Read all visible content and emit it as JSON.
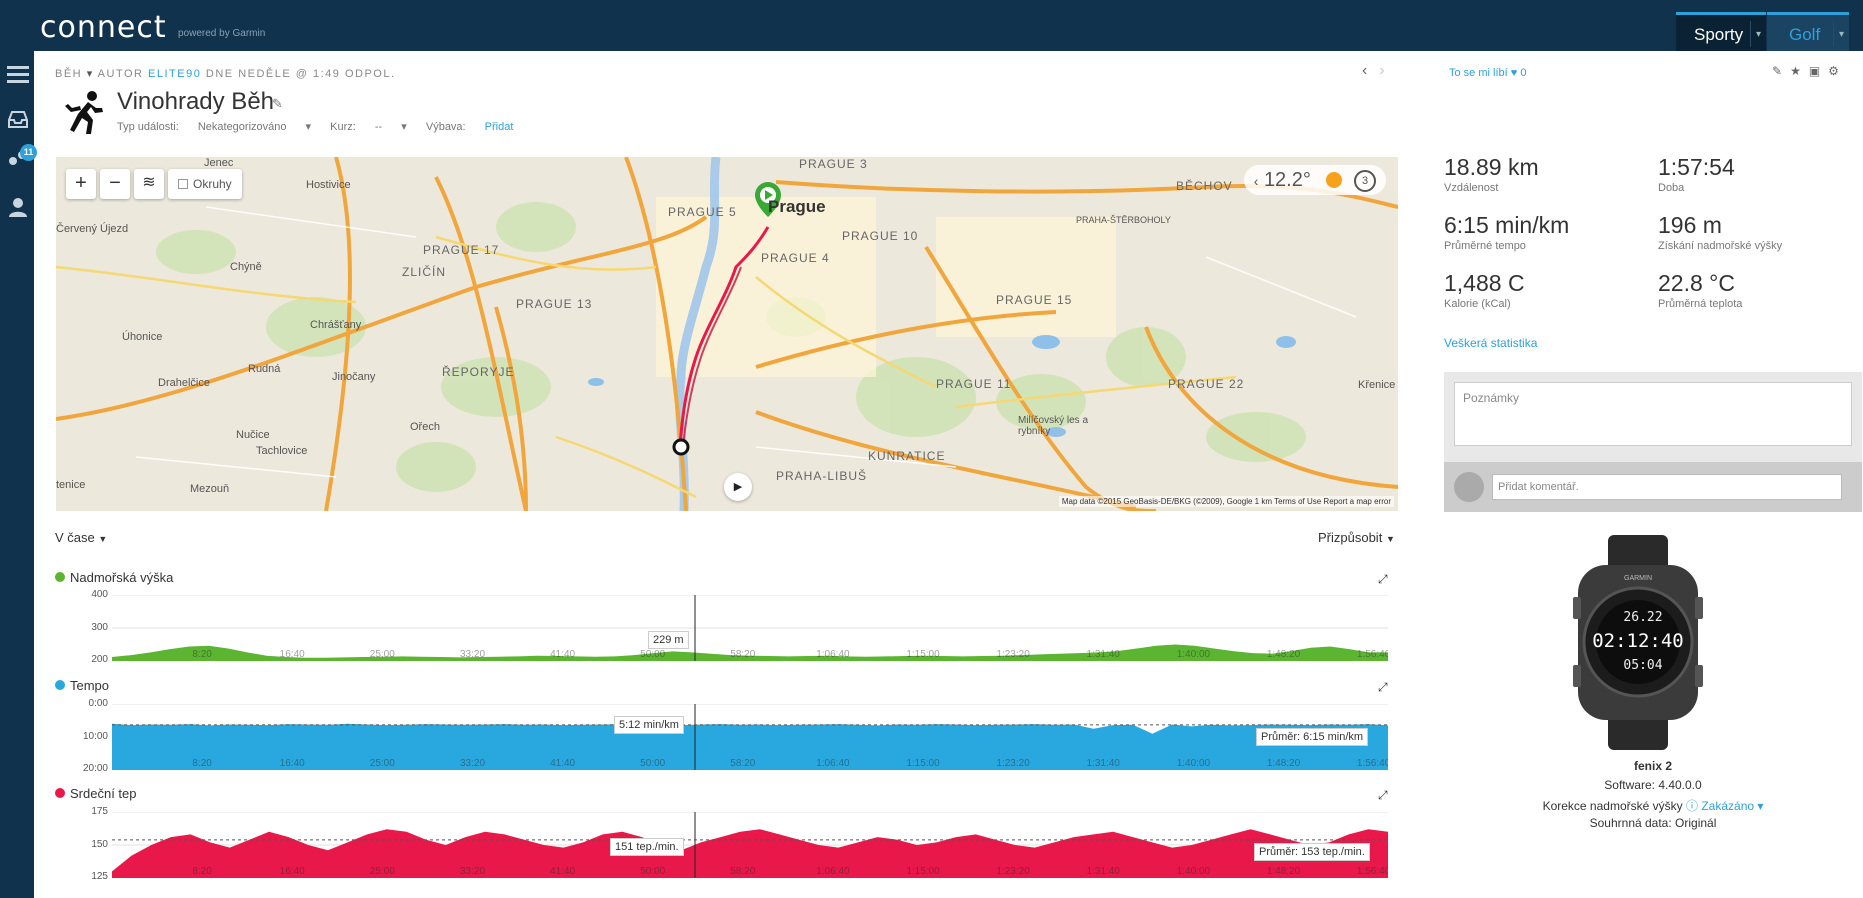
{
  "header": {
    "logo": "connect",
    "logo_sub": "powered by Garmin",
    "tab_sports": "Sporty",
    "tab_golf": "Golf"
  },
  "sidebar": {
    "notification_count": "11"
  },
  "activity": {
    "crumb_type": "BĚH",
    "crumb_author_prefix": "AUTOR",
    "crumb_author": "ELITE90",
    "crumb_date": "DNE NEDĚLE @ 1:49 ODPOL.",
    "title": "Vinohrady Běh",
    "event_type_label": "Typ události:",
    "event_type_value": "Nekategorizováno",
    "course_label": "Kurz:",
    "course_value": "--",
    "gear_label": "Výbava:",
    "gear_link": "Přidat"
  },
  "map": {
    "laps_label": "Okruhy",
    "temperature": "12.2°",
    "weather_count": "3",
    "attribution": "Map data ©2015 GeoBasis-DE/BKG (©2009), Google   1 km   Terms of Use   Report a map error",
    "labels": {
      "jenec": "Jenec",
      "hostivice": "Hostivice",
      "cerveny_ujezd": "Červený Újezd",
      "chyne": "Chýně",
      "zlicin": "ZLIČÍN",
      "prague17": "PRAGUE 17",
      "prague5": "PRAGUE 5",
      "prague3": "PRAGUE 3",
      "prague": "Prague",
      "prague4": "PRAGUE 4",
      "prague10": "PRAGUE 10",
      "prague13": "PRAGUE 13",
      "prague15": "PRAGUE 15",
      "prague11": "PRAGUE 11",
      "prague22": "PRAGUE 22",
      "beechov": "BĚCHOV",
      "uhonice": "Úhonice",
      "chrastany": "Chrášťany",
      "rudna": "Rudná",
      "jinocany": "Jinočany",
      "reporyje": "ŘEPORYJE",
      "drahelcice": "Drahelčice",
      "orech": "Ořech",
      "nucice": "Nučice",
      "tachlovice": "Tachlovice",
      "mezoun": "Mezouň",
      "tenice": "tenice",
      "kunratice": "KUNRATICE",
      "praha_libus": "PRAHA-LIBUŠ",
      "milicovsky": "Milíčovský les a rybníky",
      "kremice": "Křenice",
      "sterbohol": "PRAHA-ŠTĚRBOHOLY"
    }
  },
  "chart_controls": {
    "time_selector": "V čase",
    "fit_selector": "Přizpůsobit"
  },
  "chart_data": [
    {
      "type": "area",
      "title": "Nadmořská výška",
      "color": "#5cb531",
      "ylim": [
        200,
        400
      ],
      "yticks": [
        "400",
        "300",
        "200"
      ],
      "xticks": [
        "8:20",
        "16:40",
        "25:00",
        "33:20",
        "41:40",
        "50:00",
        "58:20",
        "1:06:40",
        "1:15:00",
        "1:23:20",
        "1:31:40",
        "1:40:00",
        "1:48:20",
        "1:56:40"
      ],
      "x_max_min": 118,
      "series": [
        {
          "values": [
            212,
            218,
            226,
            236,
            244,
            246,
            238,
            226,
            216,
            212,
            210,
            210,
            211,
            212,
            213,
            214,
            213,
            212,
            211,
            212,
            213,
            214,
            216,
            215,
            214,
            213,
            214,
            218,
            224,
            229,
            226,
            222,
            218,
            216,
            215,
            214,
            215,
            216,
            214,
            213,
            214,
            215,
            216,
            215,
            214,
            215,
            216,
            218,
            220,
            222,
            224,
            226,
            230,
            238,
            246,
            250,
            246,
            238,
            230,
            224,
            222,
            230,
            240,
            244,
            236,
            226,
            226
          ]
        }
      ],
      "tooltip": "229 m"
    },
    {
      "type": "area",
      "title": "Tempo",
      "color": "#29a8e0",
      "ylim": [
        20,
        0
      ],
      "yticks": [
        "0:00",
        "10:00",
        "20:00"
      ],
      "xticks": [
        "8:20",
        "16:40",
        "25:00",
        "33:20",
        "41:40",
        "50:00",
        "58:20",
        "1:06:40",
        "1:15:00",
        "1:23:20",
        "1:31:40",
        "1:40:00",
        "1:48:20",
        "1:56:40"
      ],
      "x_max_min": 118,
      "series": [
        {
          "values": [
            6.0,
            6.4,
            6.2,
            6.3,
            6.1,
            6.5,
            6.2,
            6.3,
            6.4,
            6.1,
            6.2,
            6.3,
            6.0,
            6.2,
            6.4,
            6.3,
            6.1,
            6.2,
            6.3,
            6.2,
            6.1,
            6.3,
            6.2,
            6.4,
            6.3,
            6.2,
            6.1,
            6.3,
            6.2,
            6.4,
            6.2,
            6.1,
            6.3,
            6.2,
            6.4,
            6.3,
            6.2,
            6.1,
            6.3,
            6.5,
            6.2,
            6.3,
            6.1,
            6.2,
            6.4,
            6.3,
            6.2,
            6.1,
            6.3,
            6.2,
            7.5,
            6.4,
            6.3,
            9.0,
            6.2,
            6.8,
            6.3,
            6.5,
            6.4,
            6.2,
            6.3,
            6.4,
            6.2,
            6.3,
            6.1,
            6.5
          ]
        }
      ],
      "tooltip": "5:12 min/km",
      "avg_label": "Průměr: 6:15 min/km"
    },
    {
      "type": "area",
      "title": "Srdeční tep",
      "color": "#e8194a",
      "ylim": [
        125,
        175
      ],
      "yticks": [
        "175",
        "150",
        "125"
      ],
      "xticks": [
        "8:20",
        "16:40",
        "25:00",
        "33:20",
        "41:40",
        "50:00",
        "58:20",
        "1:06:40",
        "1:15:00",
        "1:23:20",
        "1:31:40",
        "1:40:00",
        "1:48:20",
        "1:56:40"
      ],
      "x_max_min": 118,
      "series": [
        {
          "values": [
            130,
            142,
            150,
            156,
            158,
            152,
            148,
            154,
            160,
            156,
            150,
            146,
            152,
            158,
            162,
            160,
            154,
            150,
            156,
            160,
            158,
            154,
            150,
            148,
            152,
            158,
            160,
            156,
            150,
            146,
            152,
            156,
            160,
            162,
            158,
            154,
            150,
            148,
            152,
            156,
            154,
            150,
            152,
            156,
            158,
            154,
            150,
            148,
            152,
            156,
            158,
            160,
            156,
            152,
            148,
            150,
            154,
            158,
            162,
            158,
            154,
            150,
            152,
            158,
            162,
            160
          ]
        }
      ],
      "tooltip": "151 tep./min.",
      "avg_label": "Průměr: 153 tep./min."
    }
  ],
  "right": {
    "like_text": "To se mi líbí",
    "like_count": "0",
    "stats": [
      {
        "value": "18.89 km",
        "label": "Vzdálenost"
      },
      {
        "value": "1:57:54",
        "label": "Doba"
      },
      {
        "value": "6:15 min/km",
        "label": "Průměrné tempo"
      },
      {
        "value": "196 m",
        "label": "Získání nadmořské výšky"
      },
      {
        "value": "1,488 C",
        "label": "Kalorie (kCal)"
      },
      {
        "value": "22.8 °C",
        "label": "Průměrná teplota"
      }
    ],
    "all_stats_link": "Veškerá statistika",
    "notes_placeholder": "Poznámky",
    "comment_placeholder": "Přidat komentář.",
    "device": {
      "name": "fenix 2",
      "software": "Software: 4.40.0.0",
      "elev_corr_label": "Korekce nadmořské výšky",
      "elev_corr_value": "Zakázáno",
      "summary": "Souhrnná data: Originál",
      "watch_dist": "26.22",
      "watch_time": "02:12:40",
      "watch_pace": "05:04",
      "watch_brand": "GARMIN"
    }
  }
}
